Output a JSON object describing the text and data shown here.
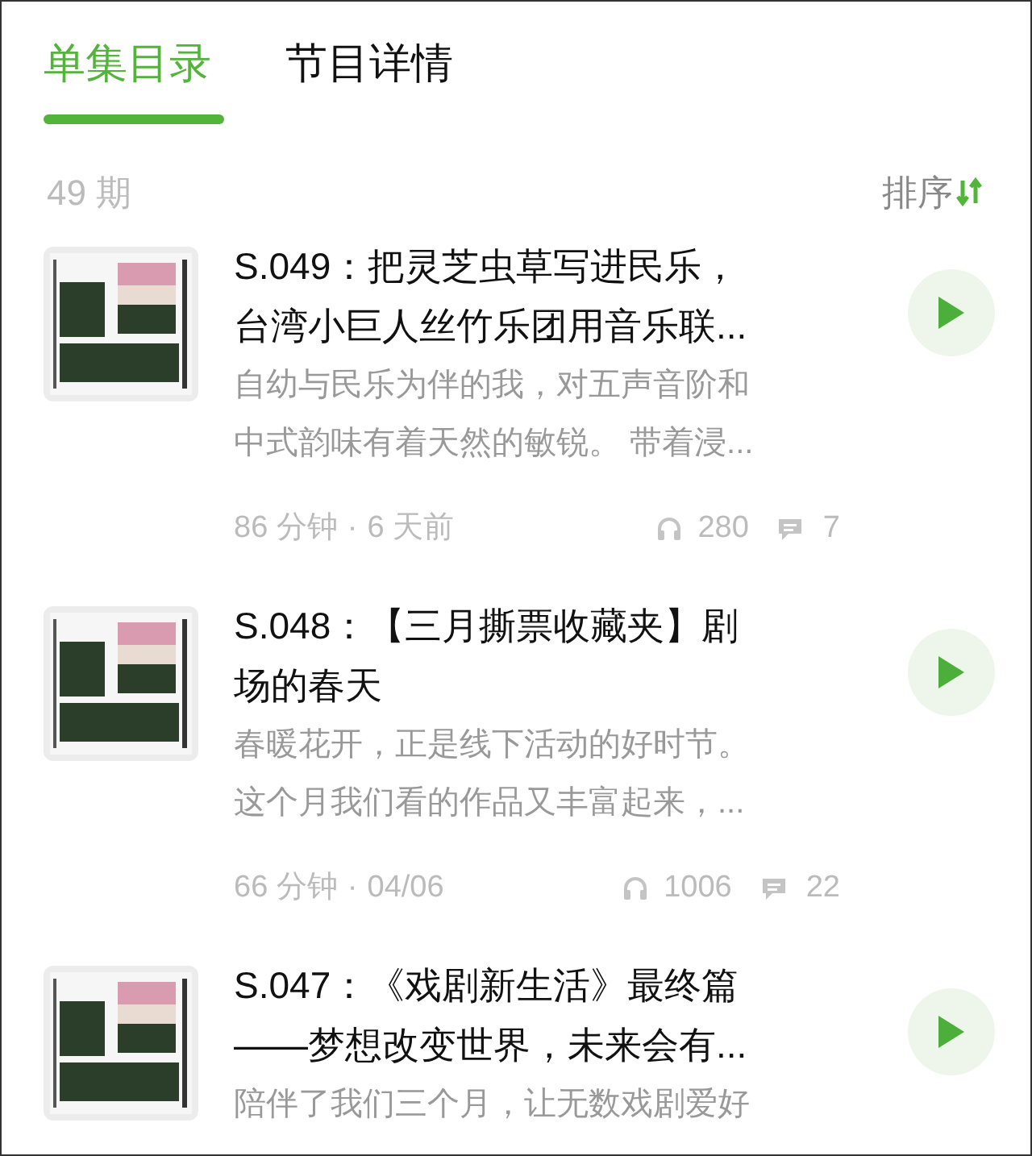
{
  "tabs": [
    {
      "label": "单集目录",
      "selected": true
    },
    {
      "label": "节目详情",
      "selected": false
    }
  ],
  "episode_count": "49 期",
  "sort": {
    "label": "排序"
  },
  "episodes": [
    {
      "title_lines": [
        "S.049：把灵芝虫草写进民乐，",
        "台湾小巨人丝竹乐团用音乐联..."
      ],
      "description_lines": [
        "自幼与民乐为伴的我，对五声音阶和",
        "中式韵味有着天然的敏锐。 带着浸..."
      ],
      "duration": "86 分钟",
      "separator": "·",
      "date": "6 天前",
      "plays": "280",
      "comments": "7"
    },
    {
      "title_lines": [
        "S.048：【三月撕票收藏夹】剧",
        "场的春天"
      ],
      "description_lines": [
        "春暖花开，正是线下活动的好时节。",
        "这个月我们看的作品又丰富起来，..."
      ],
      "duration": "66 分钟",
      "separator": "·",
      "date": "04/06",
      "plays": "1006",
      "comments": "22"
    },
    {
      "title_lines": [
        "S.047：《戏剧新生活》最终篇",
        "——梦想改变世界，未来会有..."
      ],
      "description_lines": [
        "陪伴了我们三个月，让无数戏剧爱好"
      ]
    }
  ]
}
